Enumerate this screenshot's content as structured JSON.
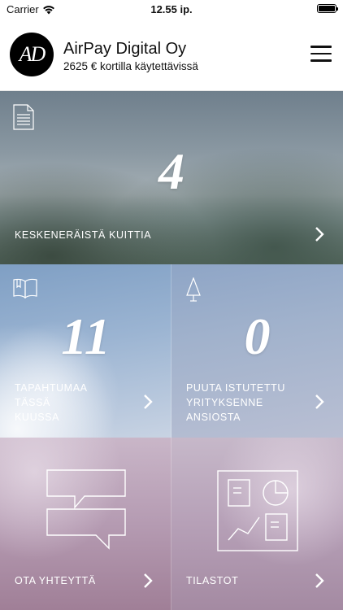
{
  "status_bar": {
    "carrier": "Carrier",
    "time": "12.55 ip."
  },
  "header": {
    "logo_text": "AD",
    "company_name": "AirPay Digital Oy",
    "balance_text": "2625 € kortilla käytettävissä"
  },
  "tiles": {
    "receipts": {
      "icon": "document-icon",
      "count": "4",
      "label": "KESKENERÄISTÄ KUITTIA"
    },
    "events": {
      "icon": "open-book-icon",
      "count": "11",
      "label_lines": [
        "TAPAHTUMAA",
        "TÄSSÄ",
        "KUUSSA"
      ]
    },
    "trees": {
      "icon": "tree-icon",
      "count": "0",
      "label_lines": [
        "PUUTA ISTUTETTU",
        "YRITYKSENNE",
        "ANSIOSTA"
      ]
    },
    "contact": {
      "icon": "chat-bubbles-icon",
      "label": "OTA YHTEYTTÄ"
    },
    "stats": {
      "icon": "dashboard-icon",
      "label": "TILASTOT"
    }
  },
  "colors": {
    "header_bg": "#ffffff",
    "logo_bg": "#000000",
    "tile_text": "#ffffff"
  }
}
